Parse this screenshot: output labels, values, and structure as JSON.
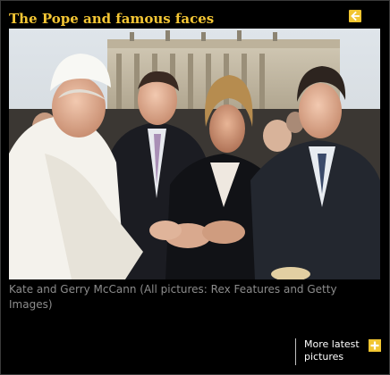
{
  "gallery": {
    "title": "The Pope and famous faces",
    "back_icon": "arrow-left-icon",
    "photo_alt": "The Pope greeting Kate and Gerry McCann",
    "caption": "Kate and Gerry McCann (All pictures: Rex Features and Getty Images)",
    "more_label_line1": "More latest",
    "more_label_line2": "pictures",
    "more_icon": "plus-icon",
    "accent_color": "#f1c531",
    "background_color": "#000000"
  }
}
